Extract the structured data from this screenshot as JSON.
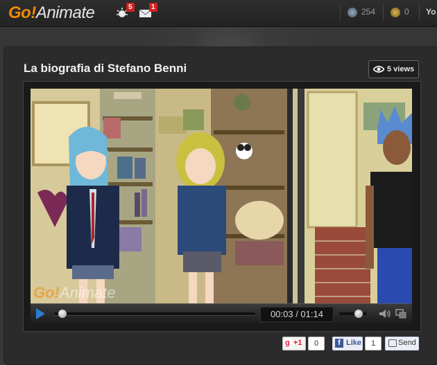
{
  "header": {
    "logo_go": "Go!",
    "logo_animate": "Animate",
    "alerts_badge": "5",
    "messages_badge": "1",
    "credits_blue": "254",
    "credits_gold": "0",
    "user_label": "Yo"
  },
  "video": {
    "title": "La biografia di Stefano Benni",
    "views": "5 views",
    "watermark_go": "Go!",
    "watermark_animate": "Animate",
    "time": "00:03 / 01:14",
    "progress": 0.04,
    "volume": 0.7
  },
  "social": {
    "gplus_label": "+1",
    "gplus_count": "0",
    "fb_like_label": "Like",
    "fb_like_count": "1",
    "send_label": "Send"
  },
  "colors": {
    "brand_orange": "#f08a00",
    "badge_red": "#d42020",
    "play_blue": "#2f7bd8"
  }
}
